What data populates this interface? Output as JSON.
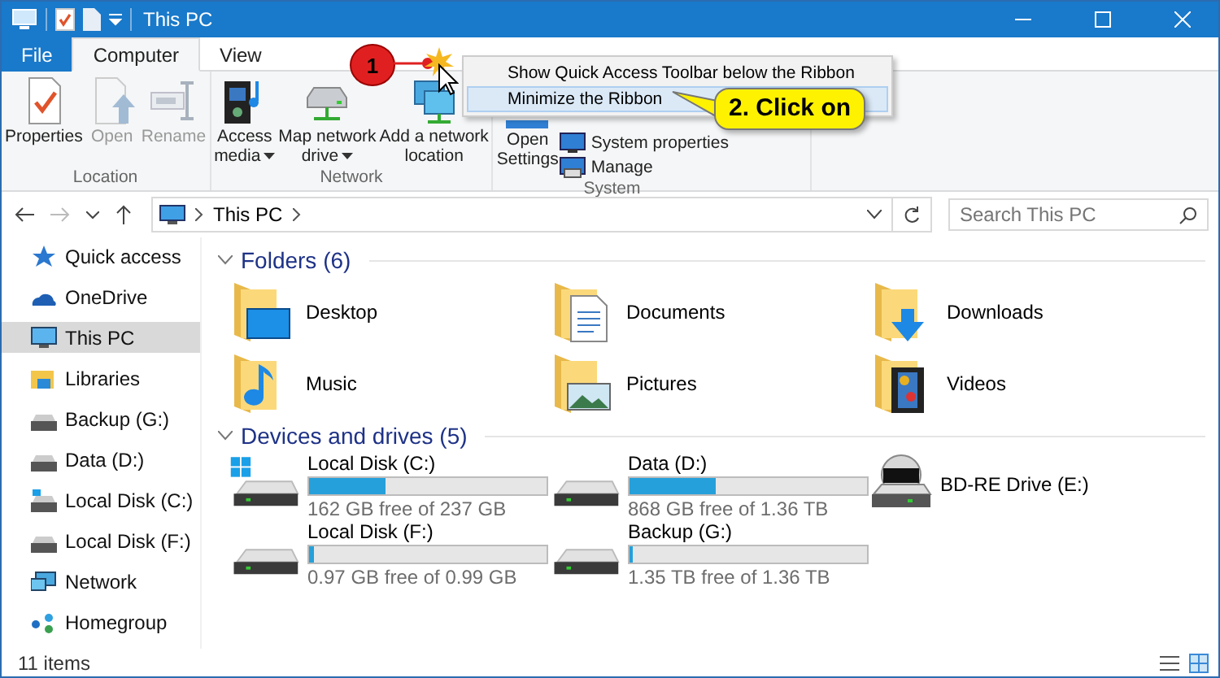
{
  "window": {
    "title": "This PC"
  },
  "ribbon_tabs": [
    {
      "label": "File",
      "selected": false,
      "kind": "file"
    },
    {
      "label": "Computer",
      "selected": true,
      "kind": "tab"
    },
    {
      "label": "View",
      "selected": false,
      "kind": "tab"
    }
  ],
  "ribbon_groups": [
    {
      "name": "Location",
      "buttons": [
        {
          "lines": [
            "Properties"
          ],
          "disabled": false,
          "dropdown": false
        },
        {
          "lines": [
            "Open"
          ],
          "disabled": true,
          "dropdown": false
        },
        {
          "lines": [
            "Rename"
          ],
          "disabled": true,
          "dropdown": false
        }
      ]
    },
    {
      "name": "Network",
      "buttons": [
        {
          "lines": [
            "Access",
            "media"
          ],
          "disabled": false,
          "dropdown": true
        },
        {
          "lines": [
            "Map network",
            "drive"
          ],
          "disabled": false,
          "dropdown": true
        },
        {
          "lines": [
            "Add a network",
            "location"
          ],
          "disabled": false,
          "dropdown": false
        }
      ]
    },
    {
      "name": "System",
      "buttons": [
        {
          "lines": [
            "Open",
            "Settings"
          ],
          "disabled": false,
          "dropdown": false
        }
      ],
      "small_buttons": [
        {
          "label": "System properties"
        },
        {
          "label": "Manage"
        }
      ]
    }
  ],
  "context_menu": {
    "items": [
      {
        "label": "Show Quick Access Toolbar below the Ribbon",
        "selected": false
      },
      {
        "label": "Minimize the Ribbon",
        "selected": true
      }
    ]
  },
  "annotations": {
    "step_marker": "1",
    "callout": "2. Click on"
  },
  "address": {
    "path": "This PC"
  },
  "search": {
    "placeholder": "Search This PC"
  },
  "sidebar": {
    "items": [
      {
        "label": "Quick access",
        "selected": false
      },
      {
        "label": "OneDrive",
        "selected": false
      },
      {
        "label": "This PC",
        "selected": true
      },
      {
        "label": "Libraries",
        "selected": false
      },
      {
        "label": "Backup (G:)",
        "selected": false
      },
      {
        "label": "Data (D:)",
        "selected": false
      },
      {
        "label": "Local Disk (C:)",
        "selected": false
      },
      {
        "label": "Local Disk (F:)",
        "selected": false
      },
      {
        "label": "Network",
        "selected": false
      },
      {
        "label": "Homegroup",
        "selected": false
      }
    ]
  },
  "sections": [
    {
      "title": "Folders (6)",
      "expanded": true,
      "kind": "folders",
      "items": [
        {
          "label": "Desktop"
        },
        {
          "label": "Documents"
        },
        {
          "label": "Downloads"
        },
        {
          "label": "Music"
        },
        {
          "label": "Pictures"
        },
        {
          "label": "Videos"
        }
      ]
    },
    {
      "title": "Devices and drives (5)",
      "expanded": true,
      "kind": "drives",
      "items": [
        {
          "label": "Local Disk (C:)",
          "kind": "disk",
          "windows": true,
          "level": 0.32,
          "free": "162 GB free of 237 GB"
        },
        {
          "label": "Data (D:)",
          "kind": "disk",
          "windows": false,
          "level": 0.36,
          "free": "868 GB free of 1.36 TB"
        },
        {
          "label": "BD-RE Drive (E:)",
          "kind": "optical"
        },
        {
          "label": "Local Disk (F:)",
          "kind": "disk",
          "windows": false,
          "level": 0.02,
          "free": "0.97 GB free of 0.99 GB"
        },
        {
          "label": "Backup (G:)",
          "kind": "disk",
          "windows": false,
          "level": 0.01,
          "free": "1.35 TB free of 1.36 TB"
        }
      ]
    }
  ],
  "status_bar": {
    "items": "11 items"
  }
}
